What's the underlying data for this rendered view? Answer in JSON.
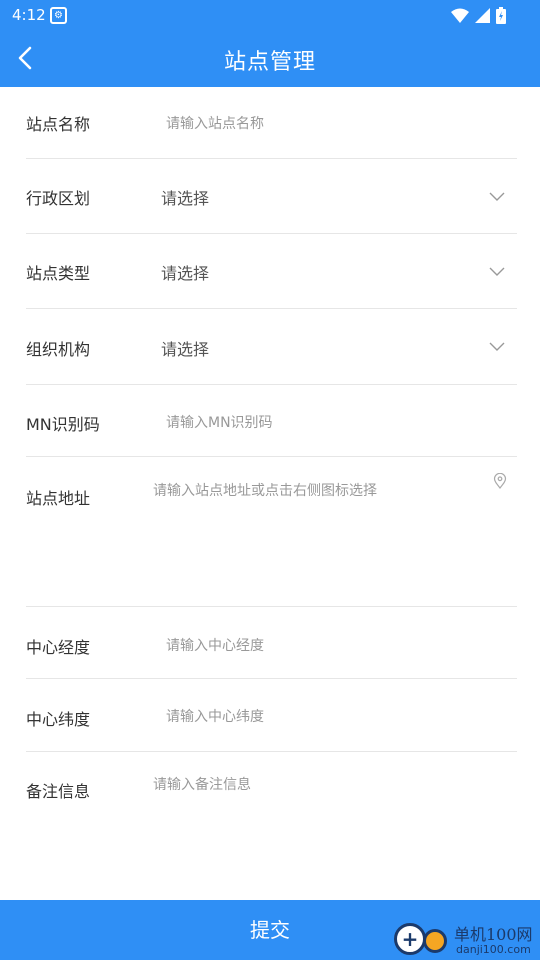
{
  "status_bar": {
    "time": "4:12"
  },
  "app_bar": {
    "title": "站点管理"
  },
  "form": {
    "station_name": {
      "label": "站点名称",
      "placeholder": "请输入站点名称"
    },
    "admin_region": {
      "label": "行政区划",
      "value": "请选择"
    },
    "station_type": {
      "label": "站点类型",
      "value": "请选择"
    },
    "organization": {
      "label": "组织机构",
      "value": "请选择"
    },
    "mn_code": {
      "label": "MN识别码",
      "placeholder": "请输入MN识别码"
    },
    "address": {
      "label": "站点地址",
      "placeholder": "请输入站点地址或点击右侧图标选择"
    },
    "center_lng": {
      "label": "中心经度",
      "placeholder": "请输入中心经度"
    },
    "center_lat": {
      "label": "中心纬度",
      "placeholder": "请输入中心纬度"
    },
    "remarks": {
      "label": "备注信息",
      "placeholder": "请输入备注信息"
    }
  },
  "submit_label": "提交",
  "watermark": {
    "brand": "单机100网",
    "url": "danji100.com"
  },
  "colors": {
    "primary": "#2f8ff5",
    "divider": "#e6e6e6"
  }
}
